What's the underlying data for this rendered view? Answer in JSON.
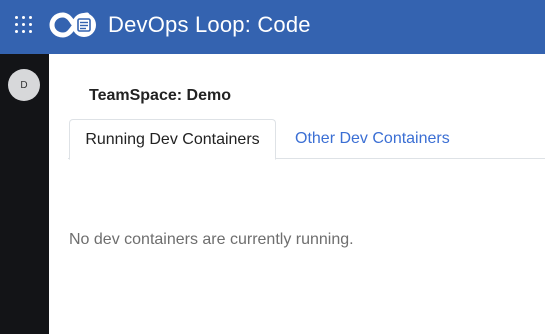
{
  "header": {
    "title": "DevOps Loop: Code",
    "background_color": "#3463b0",
    "apps_icon": "grid-dots-icon",
    "logo_icon": "devops-loop-logo"
  },
  "sidebar": {
    "background_color": "#131417",
    "avatar_initial": "D"
  },
  "main": {
    "page_title": "TeamSpace: Demo",
    "tabs": [
      {
        "label": "Running Dev Containers",
        "active": true
      },
      {
        "label": "Other Dev Containers",
        "active": false
      }
    ],
    "empty_message": "No dev containers are currently running.",
    "link_color": "#3b6fd4"
  }
}
